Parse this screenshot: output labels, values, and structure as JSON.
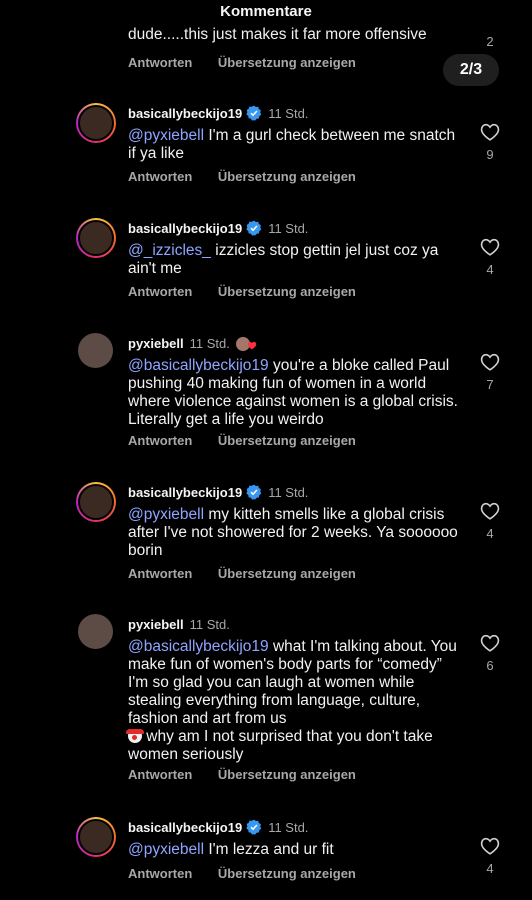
{
  "header": {
    "title": "Kommentare"
  },
  "pager": {
    "label": "2/3"
  },
  "partial_comment": {
    "text": "dude.....this just makes it far more offensive",
    "reply_label": "Antworten",
    "translate_label": "Übersetzung anzeigen",
    "like_count": "2"
  },
  "comments": [
    {
      "username": "basicallybeckijo19",
      "verified": true,
      "time": "11 Std.",
      "mention": "@pyxiebell",
      "body": " I'm a gurl check between me snatch if ya like",
      "reply_label": "Antworten",
      "translate_label": "Übersetzung anzeigen",
      "like_count": "9"
    },
    {
      "username": "basicallybeckijo19",
      "verified": true,
      "time": "11 Std.",
      "mention": "@_izzicles_",
      "body": " izzicles stop gettin jel just coz ya ain't me",
      "reply_label": "Antworten",
      "translate_label": "Übersetzung anzeigen",
      "like_count": "4"
    },
    {
      "username": "pyxiebell",
      "verified": false,
      "time": "11 Std.",
      "mention": "@basicallybeckijo19",
      "body": " you're a bloke called Paul pushing 40 making fun of women in a world where violence against women is a global crisis. Literally get a life you weirdo",
      "reply_label": "Antworten",
      "translate_label": "Übersetzung anzeigen",
      "like_count": "7"
    },
    {
      "username": "basicallybeckijo19",
      "verified": true,
      "time": "11 Std.",
      "mention": "@pyxiebell",
      "body": " my kitteh smells like a global crisis after I've not showered for 2 weeks. Ya soooooo borin",
      "reply_label": "Antworten",
      "translate_label": "Übersetzung anzeigen",
      "like_count": "4"
    },
    {
      "username": "pyxiebell",
      "verified": false,
      "time": "11 Std.",
      "mention": "@basicallybeckijo19",
      "body": " what I'm talking about. You make fun of women's body parts for “comedy” I'm so glad you can laugh at women while stealing everything from language, culture, fashion and art from us",
      "body2": " why am I not surprised that you don't take women seriously",
      "reply_label": "Antworten",
      "translate_label": "Übersetzung anzeigen",
      "like_count": "6"
    },
    {
      "username": "basicallybeckijo19",
      "verified": true,
      "time": "11 Std.",
      "mention": "@pyxiebell",
      "body": " I'm lezza and ur fit",
      "reply_label": "Antworten",
      "translate_label": "Übersetzung anzeigen",
      "like_count": "4"
    }
  ],
  "colors": {
    "mention": "#8fa5ff",
    "verified": "#3897f0",
    "muted": "#a8a8a8",
    "background": "#000000"
  },
  "icons": {
    "like": "heart-outline-icon",
    "verified": "verified-badge-icon",
    "emoji": "clown-face-icon"
  }
}
